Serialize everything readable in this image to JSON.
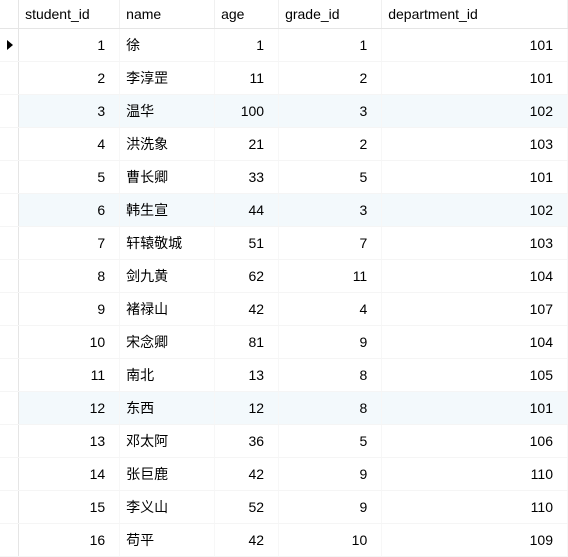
{
  "chart_data": {
    "type": "table",
    "columns": [
      "student_id",
      "name",
      "age",
      "grade_id",
      "department_id"
    ],
    "rows": [
      {
        "student_id": 1,
        "name": "徐",
        "age": 1,
        "grade_id": 1,
        "department_id": 101
      },
      {
        "student_id": 2,
        "name": "李淳罡",
        "age": 11,
        "grade_id": 2,
        "department_id": 101
      },
      {
        "student_id": 3,
        "name": "温华",
        "age": 100,
        "grade_id": 3,
        "department_id": 102
      },
      {
        "student_id": 4,
        "name": "洪洗象",
        "age": 21,
        "grade_id": 2,
        "department_id": 103
      },
      {
        "student_id": 5,
        "name": "曹长卿",
        "age": 33,
        "grade_id": 5,
        "department_id": 101
      },
      {
        "student_id": 6,
        "name": "韩生宣",
        "age": 44,
        "grade_id": 3,
        "department_id": 102
      },
      {
        "student_id": 7,
        "name": "轩辕敬城",
        "age": 51,
        "grade_id": 7,
        "department_id": 103
      },
      {
        "student_id": 8,
        "name": "剑九黄",
        "age": 62,
        "grade_id": 11,
        "department_id": 104
      },
      {
        "student_id": 9,
        "name": "褚禄山",
        "age": 42,
        "grade_id": 4,
        "department_id": 107
      },
      {
        "student_id": 10,
        "name": "宋念卿",
        "age": 81,
        "grade_id": 9,
        "department_id": 104
      },
      {
        "student_id": 11,
        "name": "南北",
        "age": 13,
        "grade_id": 8,
        "department_id": 105
      },
      {
        "student_id": 12,
        "name": "东西",
        "age": 12,
        "grade_id": 8,
        "department_id": 101
      },
      {
        "student_id": 13,
        "name": "邓太阿",
        "age": 36,
        "grade_id": 5,
        "department_id": 106
      },
      {
        "student_id": 14,
        "name": "张巨鹿",
        "age": 42,
        "grade_id": 9,
        "department_id": 110
      },
      {
        "student_id": 15,
        "name": "李义山",
        "age": 52,
        "grade_id": 9,
        "department_id": 110
      },
      {
        "student_id": 16,
        "name": "苟平",
        "age": 42,
        "grade_id": 10,
        "department_id": 109
      }
    ]
  },
  "headers": {
    "student_id": "student_id",
    "name": "name",
    "age": "age",
    "grade_id": "grade_id",
    "department_id": "department_id"
  },
  "current_row_index": 0,
  "alt_rows": [
    2,
    5,
    11
  ]
}
